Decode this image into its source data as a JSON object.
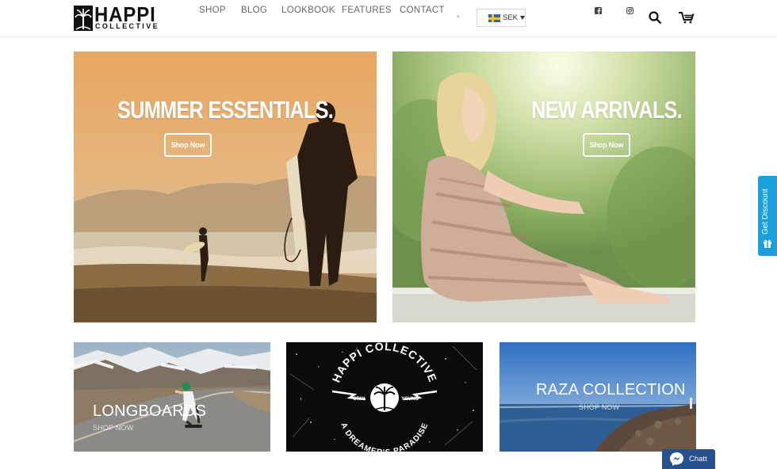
{
  "brand": {
    "name": "HAPPI",
    "tagline": "COLLECTIVE"
  },
  "nav": [
    {
      "label": "SHOP"
    },
    {
      "label": "BLOG"
    },
    {
      "label": "LOOKBOOK"
    },
    {
      "label": "FEATURES"
    },
    {
      "label": "CONTACT"
    }
  ],
  "dot": "°",
  "currency": {
    "code": "SEK",
    "flag": "sweden-flag-icon"
  },
  "header_icons": [
    "facebook-icon",
    "instagram-icon",
    "search-icon",
    "cart-icon"
  ],
  "tiles": {
    "summer": {
      "title": "SUMMER ESSENTIALS.",
      "button": "Shop Now"
    },
    "arrivals": {
      "title": "NEW ARRIVALS.",
      "button": "Shop Now"
    },
    "longboards": {
      "title": "LONGBOARDS",
      "sub": "SHOP NOW"
    },
    "paradise": {
      "circle_top": "HAPPI COLLECTIVE",
      "left": "STAY",
      "right": "YOUNG",
      "bottom": "A DREAMER'S PARADISE"
    },
    "raza": {
      "title": "RAZA COLLECTION",
      "sub": "SHOP NOW"
    }
  },
  "discount": {
    "label": "Get Discount"
  },
  "chat": {
    "label": "Chatt"
  },
  "colors": {
    "discount_tab": "#1aa0dc",
    "chat_button": "#27508e"
  }
}
